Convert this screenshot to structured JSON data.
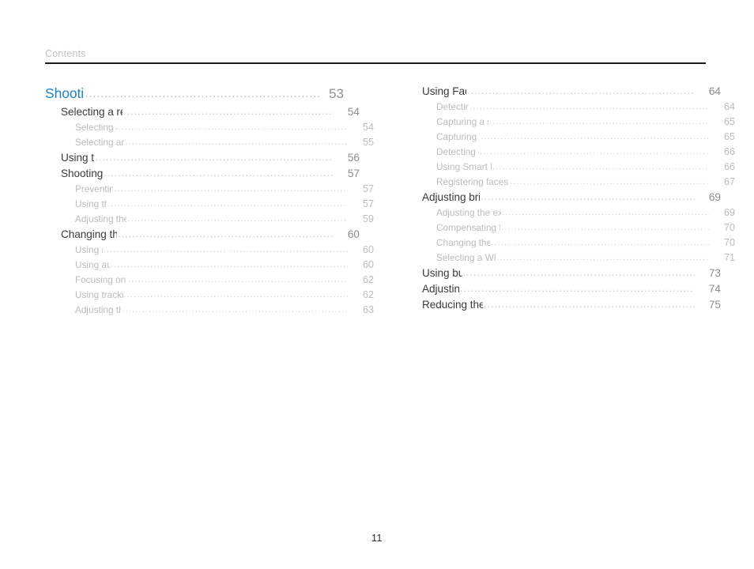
{
  "header": {
    "label": "Contents"
  },
  "footer": {
    "page_number": "11"
  },
  "colors": {
    "chapter_blue": "#1f82c6",
    "section_dark": "#3a3a3a",
    "subsection_gray": "#bcbcbc",
    "leader_gray": "#cfcfcf",
    "rule_black": "#1a1a1a",
    "header_gray": "#c2c2c2",
    "background": "#ffffff"
  },
  "columns": [
    {
      "name": "left",
      "entries": [
        {
          "level": 1,
          "title": "Shooting options",
          "page": "53"
        },
        {
          "level": 2,
          "title": "Selecting a resolution and quality",
          "page": "54"
        },
        {
          "level": 3,
          "title": "Selecting a resolution",
          "page": "54"
        },
        {
          "level": 3,
          "title": "Selecting an image quality",
          "page": "55"
        },
        {
          "level": 2,
          "title": "Using the timer",
          "page": "56"
        },
        {
          "level": 2,
          "title": "Shooting in the dark",
          "page": "57"
        },
        {
          "level": 3,
          "title": "Preventing red-eye",
          "page": "57"
        },
        {
          "level": 3,
          "title": "Using the flash",
          "page": "57"
        },
        {
          "level": 3,
          "title": "Adjusting the ISO sensitivity",
          "page": "59"
        },
        {
          "level": 2,
          "title": "Changing the camera’s focus",
          "page": "60"
        },
        {
          "level": 3,
          "title": "Using macro",
          "page": "60"
        },
        {
          "level": 3,
          "title": "Using auto focus",
          "page": "60"
        },
        {
          "level": 3,
          "title": "Focusing on a selected area",
          "page": "62"
        },
        {
          "level": 3,
          "title": "Using tracking auto focus",
          "page": "62"
        },
        {
          "level": 3,
          "title": "Adjusting the focus area",
          "page": "63"
        }
      ]
    },
    {
      "name": "right",
      "entries": [
        {
          "level": 2,
          "title": "Using Face Detection",
          "page": "64"
        },
        {
          "level": 3,
          "title": "Detecting faces",
          "page": "64"
        },
        {
          "level": 3,
          "title": "Capturing a self portrait shot",
          "page": "65"
        },
        {
          "level": 3,
          "title": "Capturing a smile shot",
          "page": "65"
        },
        {
          "level": 3,
          "title": "Detecting eye blinking",
          "page": "66"
        },
        {
          "level": 3,
          "title": "Using Smart Face Recognition",
          "page": "66"
        },
        {
          "level": 3,
          "title": "Registering faces as your favorites (My Star)",
          "page": "67"
        },
        {
          "level": 2,
          "title": "Adjusting brightness and color",
          "page": "69"
        },
        {
          "level": 3,
          "title": "Adjusting the exposure manually (EV)",
          "page": "69"
        },
        {
          "level": 3,
          "title": "Compensating for backlighting (ACB)",
          "page": "70"
        },
        {
          "level": 3,
          "title": "Changing the metering option",
          "page": "70"
        },
        {
          "level": 3,
          "title": "Selecting a White Balance setting",
          "page": "71"
        },
        {
          "level": 2,
          "title": "Using burst modes",
          "page": "73"
        },
        {
          "level": 2,
          "title": "Adjusting images",
          "page": "74"
        },
        {
          "level": 2,
          "title": "Reducing the sound of the zoom",
          "page": "75"
        }
      ]
    }
  ]
}
